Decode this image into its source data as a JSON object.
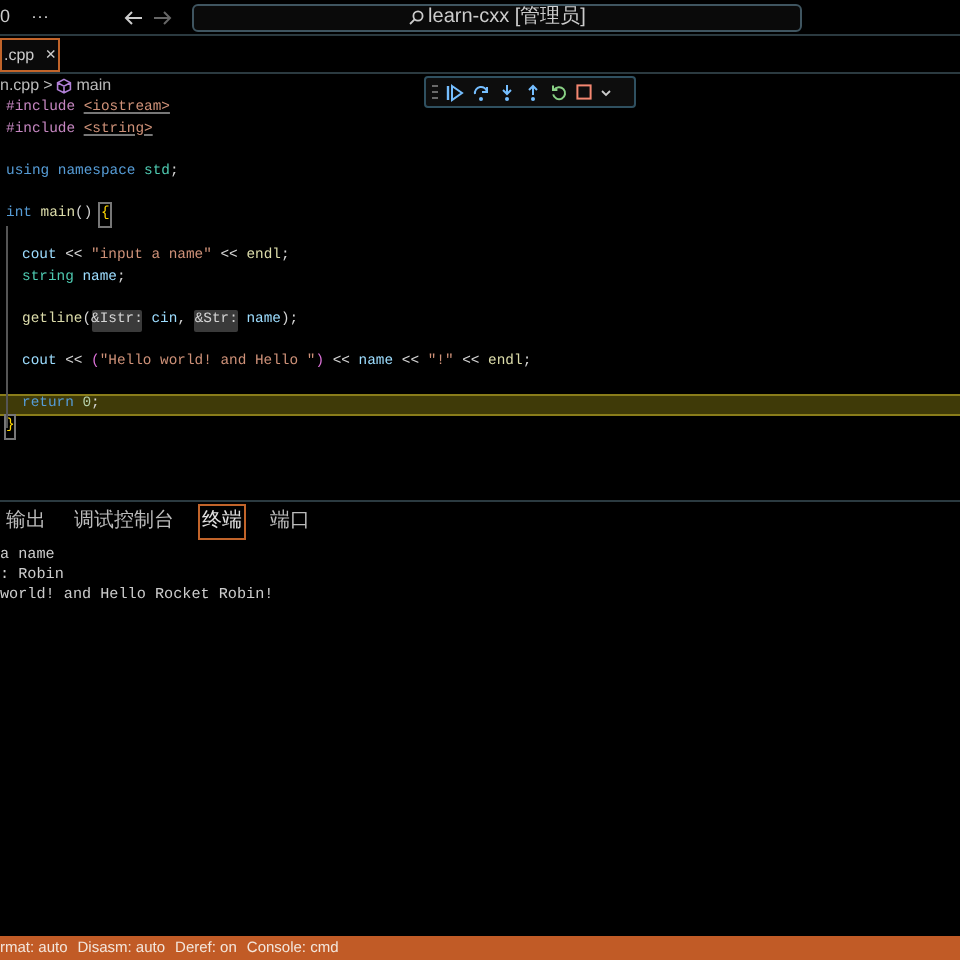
{
  "title_bar": {
    "left_text": "0",
    "more": "···",
    "search": "learn-cxx [管理员]"
  },
  "tab": {
    "label": ".cpp",
    "close": "×",
    "selected": true
  },
  "breadcrumb": {
    "file": "n.cpp",
    "separator": ">",
    "symbol": "main"
  },
  "editor": {
    "lines": [
      {
        "kind": "code",
        "tokens": [
          {
            "kind": "pre",
            "text": "#include "
          },
          {
            "kind": "inc",
            "text": "<iostream>"
          }
        ]
      },
      {
        "kind": "code",
        "tokens": [
          {
            "kind": "pre",
            "text": "#include "
          },
          {
            "kind": "inc",
            "text": "<string>"
          }
        ]
      },
      {
        "kind": "blank"
      },
      {
        "kind": "code",
        "tokens": [
          {
            "kind": "kw",
            "text": "using "
          },
          {
            "kind": "kw",
            "text": "namespace "
          },
          {
            "kind": "type",
            "text": "std"
          },
          {
            "kind": "plain",
            "text": ";"
          }
        ]
      },
      {
        "kind": "blank"
      },
      {
        "kind": "code",
        "tokens": [
          {
            "kind": "kw",
            "text": "int "
          },
          {
            "kind": "fn",
            "text": "main"
          },
          {
            "kind": "plain",
            "text": "() "
          },
          {
            "kind": "brace",
            "text": "{"
          }
        ]
      },
      {
        "kind": "blank"
      },
      {
        "kind": "code",
        "indented": true,
        "tokens": [
          {
            "kind": "var",
            "text": "cout "
          },
          {
            "kind": "plain",
            "text": "<< "
          },
          {
            "kind": "str",
            "text": "\"input a name\""
          },
          {
            "kind": "plain",
            "text": " << "
          },
          {
            "kind": "fn",
            "text": "endl"
          },
          {
            "kind": "plain",
            "text": ";"
          }
        ]
      },
      {
        "kind": "code",
        "indented": true,
        "tokens": [
          {
            "kind": "type",
            "text": "string "
          },
          {
            "kind": "var",
            "text": "name"
          },
          {
            "kind": "plain",
            "text": ";"
          }
        ]
      },
      {
        "kind": "blank"
      },
      {
        "kind": "code",
        "indented": true,
        "tokens": [
          {
            "kind": "fn",
            "text": "getline"
          },
          {
            "kind": "plain",
            "text": "("
          },
          {
            "kind": "hint",
            "text": "&Istr:"
          },
          {
            "kind": "var",
            "text": " cin"
          },
          {
            "kind": "plain",
            "text": ", "
          },
          {
            "kind": "hint",
            "text": "&Str:"
          },
          {
            "kind": "var",
            "text": " name"
          },
          {
            "kind": "plain",
            "text": ");"
          }
        ]
      },
      {
        "kind": "blank"
      },
      {
        "kind": "code",
        "indented": true,
        "tokens": [
          {
            "kind": "var",
            "text": "cout "
          },
          {
            "kind": "plain",
            "text": "<< "
          },
          {
            "kind": "paren",
            "text": "("
          },
          {
            "kind": "str",
            "text": "\"Hello world! and Hello \""
          },
          {
            "kind": "paren",
            "text": ")"
          },
          {
            "kind": "plain",
            "text": " << "
          },
          {
            "kind": "var",
            "text": "name"
          },
          {
            "kind": "plain",
            "text": " << "
          },
          {
            "kind": "str",
            "text": "\"!\""
          },
          {
            "kind": "plain",
            "text": " << "
          },
          {
            "kind": "fn",
            "text": "endl"
          },
          {
            "kind": "plain",
            "text": ";"
          }
        ]
      },
      {
        "kind": "blank"
      },
      {
        "kind": "code",
        "indented": true,
        "current": true,
        "tokens": [
          {
            "kind": "kw",
            "text": "return "
          },
          {
            "kind": "num",
            "text": "0"
          },
          {
            "kind": "plain",
            "text": ";"
          }
        ]
      },
      {
        "kind": "code",
        "tokens": [
          {
            "kind": "brace",
            "text": "}"
          }
        ]
      }
    ]
  },
  "panel": {
    "tabs": [
      {
        "label": "输出",
        "selected": false
      },
      {
        "label": "调试控制台",
        "selected": false
      },
      {
        "label": "终端",
        "selected": true
      },
      {
        "label": "端口",
        "selected": false
      }
    ],
    "terminal_lines": [
      "a name",
      ": Robin",
      "world! and Hello Rocket Robin!"
    ]
  },
  "status_bar": {
    "items": [
      "rmat: auto",
      "Disasm: auto",
      "Deref: on",
      "Console: cmd"
    ]
  }
}
